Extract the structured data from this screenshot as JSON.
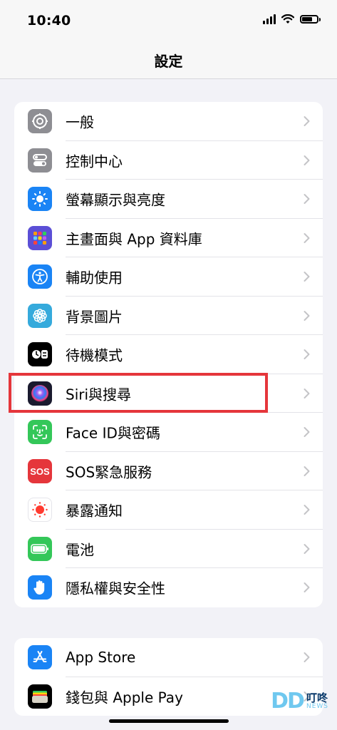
{
  "status_bar": {
    "time": "10:40",
    "battery_level": 0.8
  },
  "page": {
    "title": "設定"
  },
  "groups": [
    {
      "items": [
        {
          "label": "一般",
          "icon": "gear-icon",
          "color": "#8e8e93"
        },
        {
          "label": "控制中心",
          "icon": "toggles-icon",
          "color": "#8e8e93"
        },
        {
          "label": "螢幕顯示與亮度",
          "icon": "sun-icon",
          "color": "#1a84f5"
        },
        {
          "label": "主畫面與 App 資料庫",
          "icon": "app-grid-icon",
          "color": "#5b4fd6"
        },
        {
          "label": "輔助使用",
          "icon": "accessibility-icon",
          "color": "#1a84f5"
        },
        {
          "label": "背景圖片",
          "icon": "flower-icon",
          "color": "#35aadc"
        },
        {
          "label": "待機模式",
          "icon": "standby-icon",
          "color": "#000000"
        },
        {
          "label": "Siri與搜尋",
          "icon": "siri-icon",
          "color": "#1a1a2e"
        },
        {
          "label": "Face ID與密碼",
          "icon": "face-id-icon",
          "color": "#34c759"
        },
        {
          "label": "SOS緊急服務",
          "icon": "sos-icon",
          "color": "#e5363b"
        },
        {
          "label": "暴露通知",
          "icon": "exposure-icon",
          "color": "#ffffff"
        },
        {
          "label": "電池",
          "icon": "battery-icon",
          "color": "#34c759"
        },
        {
          "label": "隱私權與安全性",
          "icon": "hand-icon",
          "color": "#1a84f5"
        }
      ]
    },
    {
      "items": [
        {
          "label": "App Store",
          "icon": "app-store-icon",
          "color": "#1a84f5"
        },
        {
          "label": "錢包與 Apple Pay",
          "icon": "wallet-icon",
          "color": "#000000"
        }
      ]
    }
  ],
  "highlight": {
    "target": "Siri與搜尋",
    "color": "#e5363b"
  },
  "watermark": {
    "logo": "DD",
    "cn": "叮咚",
    "en": "NEWS"
  }
}
